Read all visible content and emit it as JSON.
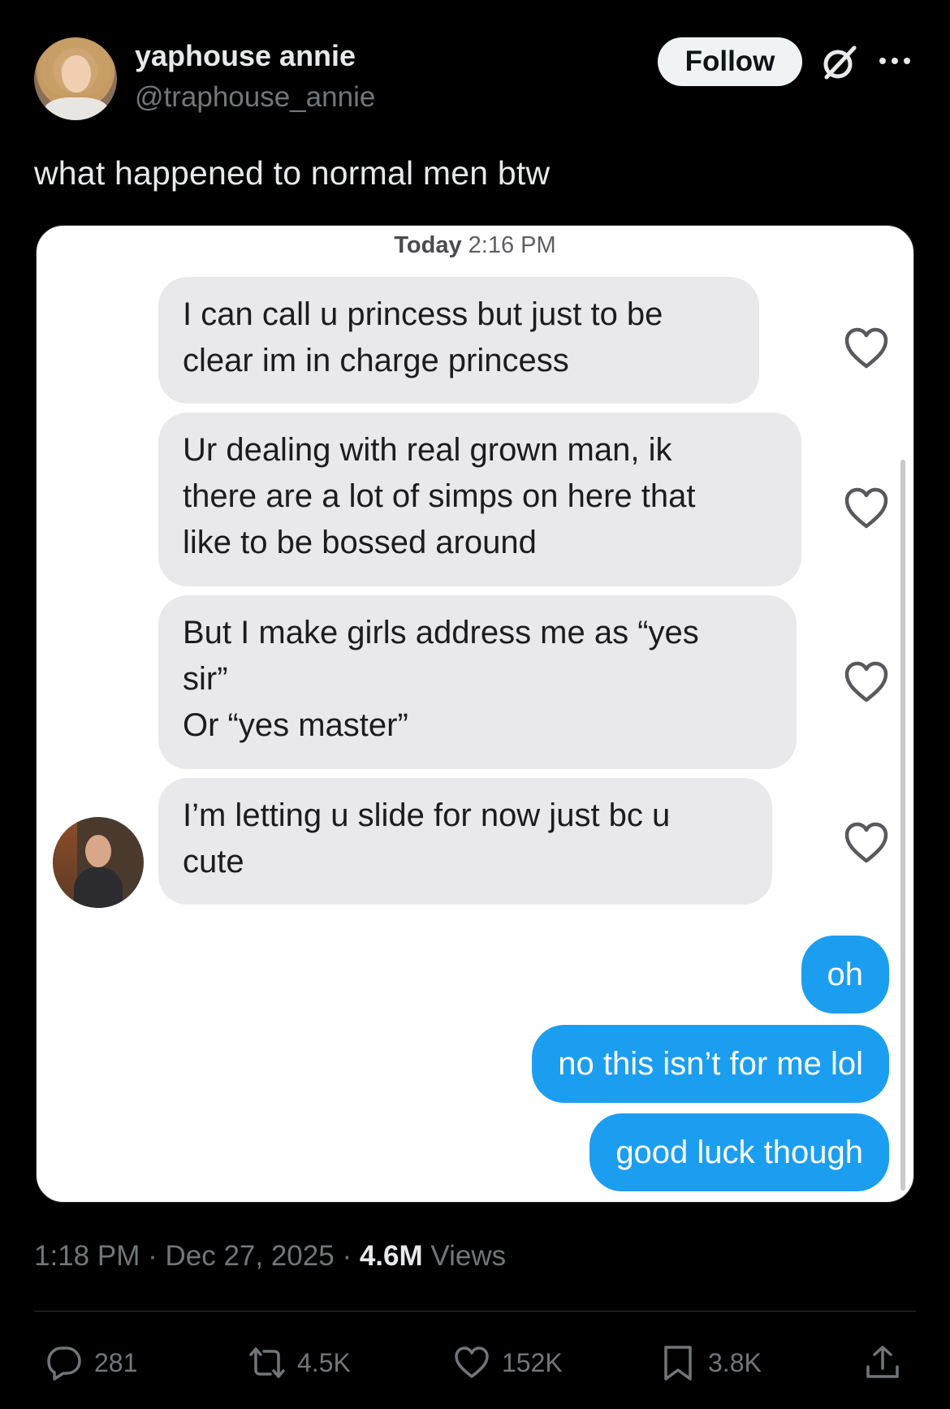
{
  "post": {
    "display_name": "yaphouse annie",
    "handle": "@traphouse_annie",
    "follow_label": "Follow",
    "text": "what happened to normal men btw",
    "time": "1:18 PM",
    "separator": "·",
    "date": "Dec 27, 2025",
    "views_count": "4.6M",
    "views_label": "Views"
  },
  "screenshot": {
    "stamp_day": "Today",
    "stamp_time": "2:16 PM",
    "incoming": [
      {
        "lines": [
          "I can call u princess but just to be",
          "clear im in charge princess"
        ]
      },
      {
        "lines": [
          "Ur dealing with real grown man, ik",
          "there are a lot of simps on here that",
          "like to be bossed around"
        ]
      },
      {
        "lines": [
          "But I make girls address me as “yes",
          "sir”",
          "Or “yes master”"
        ]
      },
      {
        "lines": [
          "I’m letting u slide for now just bc u",
          "cute"
        ]
      }
    ],
    "outgoing": [
      "oh",
      "no this isn’t for me lol",
      "good luck though"
    ]
  },
  "actions": {
    "replies": "281",
    "reposts": "4.5K",
    "likes": "152K",
    "bookmarks": "3.8K"
  },
  "icons": [
    "grok-icon",
    "more-icon",
    "heart-icon",
    "reply-icon",
    "repost-icon",
    "like-icon",
    "bookmark-icon",
    "share-icon"
  ],
  "colors": {
    "background": "#000000",
    "text": "#e7e9ea",
    "muted": "#71767b",
    "outgoing_bubble": "#1c9ef0",
    "incoming_bubble": "#e9e9ec"
  }
}
